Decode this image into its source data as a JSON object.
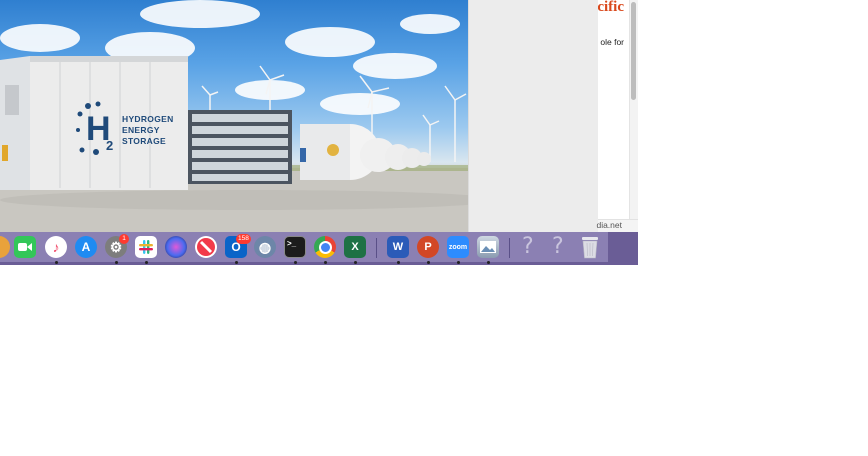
{
  "hero": {
    "h2_symbol": "H",
    "h2_subscript": "2",
    "lines": [
      "HYDROGEN",
      "ENERGY",
      "STORAGE"
    ]
  },
  "article": {
    "title_fragment": "cific",
    "snippet_fragment": "ole for",
    "url_fragment": "dia.net"
  },
  "dock": {
    "items": [
      {
        "name": "photos",
        "color": "#e9a23b",
        "label": ""
      },
      {
        "name": "facetime",
        "color": "#33c759",
        "label": ""
      },
      {
        "name": "music",
        "color": "#f24b6a",
        "label": "♪"
      },
      {
        "name": "app-store",
        "color": "#1f8bf2",
        "label": "A"
      },
      {
        "name": "system-preferences",
        "color": "#7d7d7d",
        "label": "⚙",
        "badge": "1"
      },
      {
        "name": "slack",
        "color": "#ffffff",
        "label": "#"
      },
      {
        "name": "siri",
        "color": "#3a2c7a",
        "label": "◉"
      },
      {
        "name": "news",
        "color": "#f23a4a",
        "label": "N"
      },
      {
        "name": "outlook",
        "color": "#0a64c8",
        "label": "O",
        "badge": "158"
      },
      {
        "name": "network-utility",
        "color": "#6d86a8",
        "label": "◍"
      },
      {
        "name": "terminal",
        "color": "#1c1c1c",
        "label": ">_"
      },
      {
        "name": "chrome",
        "color": "#e8e8e8",
        "label": ""
      },
      {
        "name": "excel",
        "color": "#1e7145",
        "label": "X"
      },
      {
        "name": "word",
        "color": "#2b5bb8",
        "label": "W"
      },
      {
        "name": "powerpoint",
        "color": "#d24726",
        "label": "P"
      },
      {
        "name": "zoom",
        "color": "#2d8cff",
        "label": "zoom"
      },
      {
        "name": "preview",
        "color": "#9aa7b5",
        "label": ""
      },
      {
        "name": "unknown-app-1",
        "label": "?"
      },
      {
        "name": "unknown-app-2",
        "label": "?"
      },
      {
        "name": "trash",
        "label": ""
      }
    ]
  }
}
